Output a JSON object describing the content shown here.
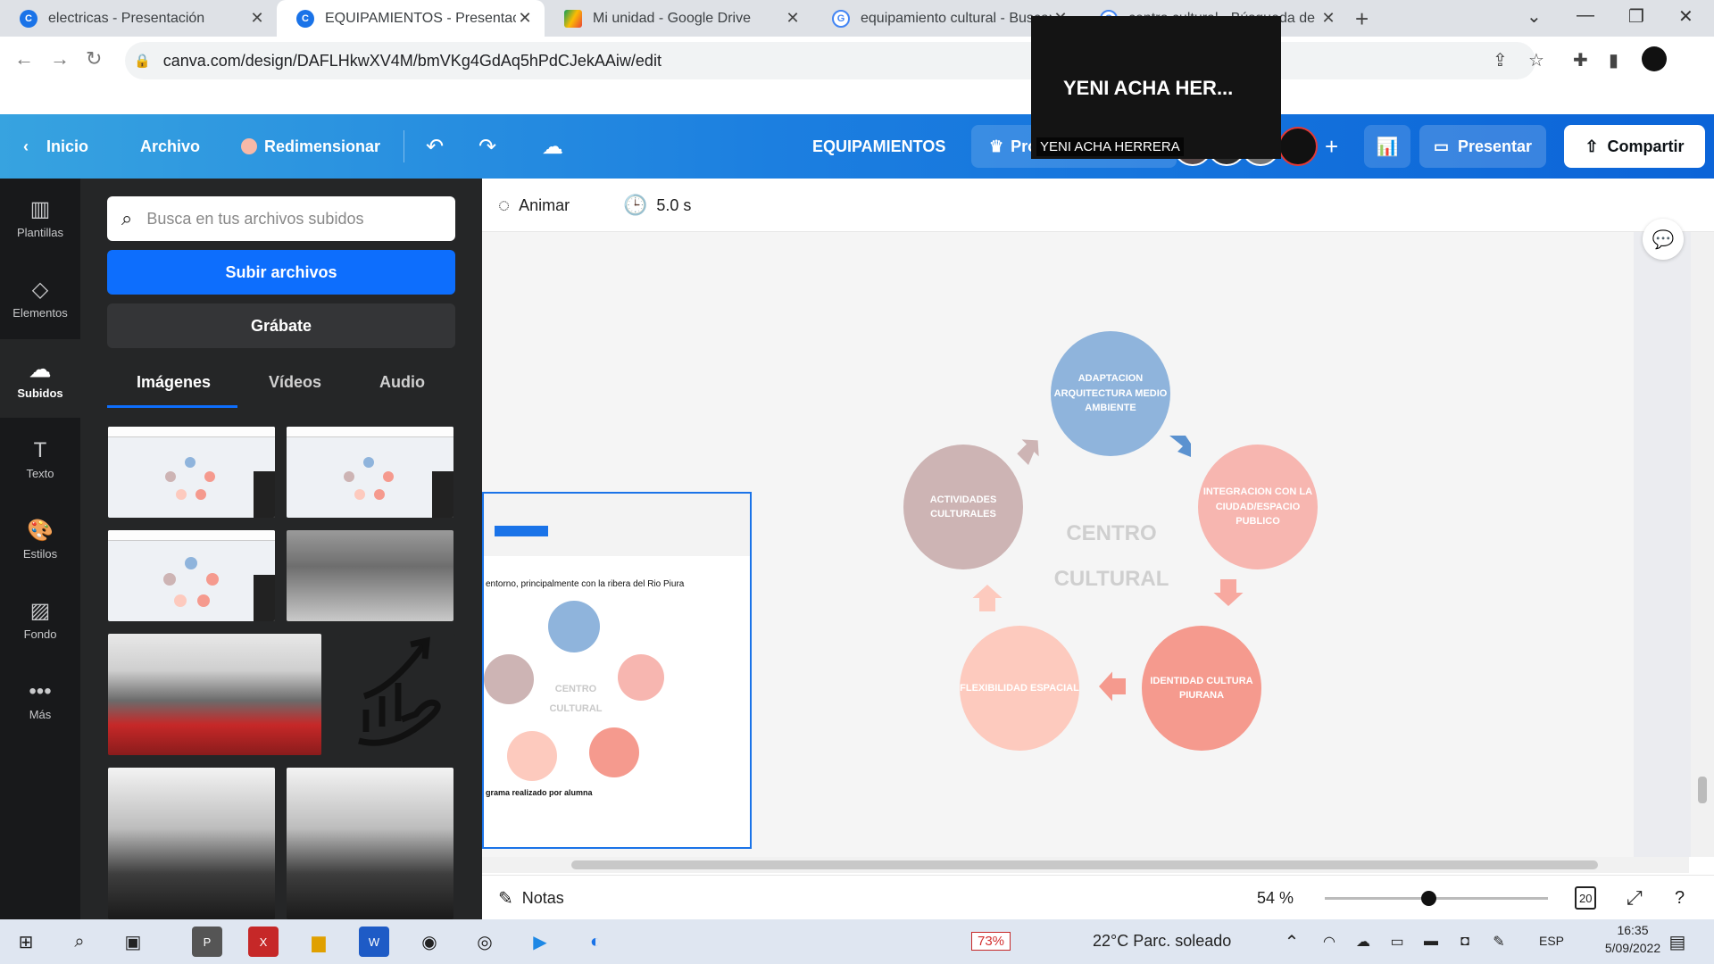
{
  "browser": {
    "tabs": [
      {
        "title": "electricas - Presentación",
        "icon": "canva-icon"
      },
      {
        "title": "EQUIPAMIENTOS - Presentación",
        "icon": "canva-icon",
        "active": true
      },
      {
        "title": "Mi unidad - Google Drive",
        "icon": "drive-icon"
      },
      {
        "title": "equipamiento cultural - Buscar",
        "icon": "google-icon"
      },
      {
        "title": "centro cultural - Búsqueda de Go",
        "icon": "google-icon"
      }
    ],
    "url": "canva.com/design/DAFLHkwXV4M/bmVKg4GdAq5hPdCJekAAiw/edit"
  },
  "video_overlay": {
    "name": "YENI ACHA HER...",
    "caption": "YENI ACHA HERRERA"
  },
  "canva_top": {
    "home": "Inicio",
    "file": "Archivo",
    "resize": "Redimensionar",
    "title": "EQUIPAMIENTOS",
    "pro": "Pro",
    "present": "Presentar",
    "share": "Compartir"
  },
  "rail": [
    {
      "label": "Plantillas",
      "icon": "template-icon"
    },
    {
      "label": "Elementos",
      "icon": "elements-icon"
    },
    {
      "label": "Subidos",
      "icon": "upload-icon",
      "active": true
    },
    {
      "label": "Texto",
      "icon": "text-icon"
    },
    {
      "label": "Estilos",
      "icon": "palette-icon"
    },
    {
      "label": "Fondo",
      "icon": "background-icon"
    },
    {
      "label": "Más",
      "icon": "more-icon"
    }
  ],
  "panel": {
    "search_placeholder": "Busca en tus archivos subidos",
    "upload": "Subir archivos",
    "record": "Grábate",
    "tabs": [
      "Imágenes",
      "Vídeos",
      "Audio"
    ]
  },
  "editor": {
    "animate": "Animar",
    "duration": "5.0 s",
    "notes": "Notas",
    "zoom": "54 %",
    "page_count": "20"
  },
  "diagram": {
    "center": [
      "CENTRO",
      "CULTURAL"
    ],
    "nodes": [
      {
        "text": "ADAPTACION ARQUITECTURA MEDIO AMBIENTE",
        "color": "#8fb4dc"
      },
      {
        "text": "INTEGRACION CON LA CIUDAD/ESPACIO PUBLICO",
        "color": "#f7b6b0"
      },
      {
        "text": "IDENTIDAD CULTURA PIURANA",
        "color": "#f59a8e"
      },
      {
        "text": "FLEXIBILIDAD ESPACIAL",
        "color": "#fdcabe"
      },
      {
        "text": "ACTIVIDADES CULTURALES",
        "color": "#cdb4b4"
      }
    ]
  },
  "embed": {
    "line1": "entorno, principalmente con la ribera del Rio Piura",
    "line2": "grama realizado por alumna",
    "centro": [
      "CENTRO",
      "CULTURAL"
    ]
  },
  "taskbar": {
    "battery": "73%",
    "weather": "22°C  Parc. soleado",
    "lang": "ESP",
    "time": "16:35",
    "date": "5/09/2022"
  }
}
